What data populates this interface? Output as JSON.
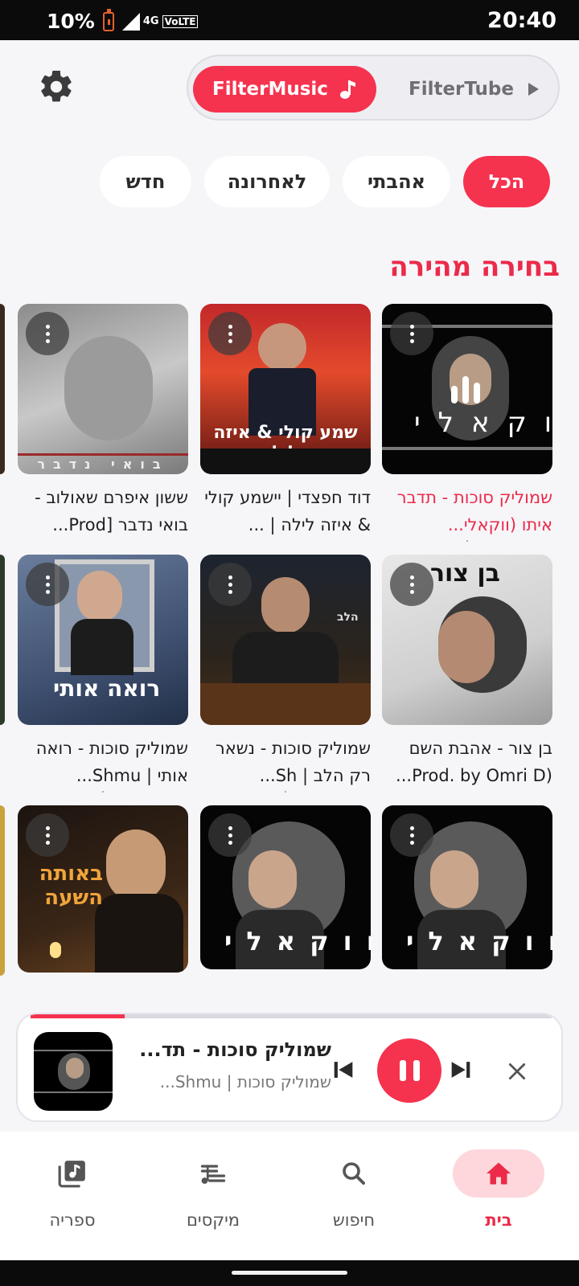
{
  "status_bar": {
    "battery": "10%",
    "network": "4G",
    "volte": "VoLTE",
    "time": "20:40"
  },
  "header": {
    "settings_icon": "gear-icon",
    "segments": [
      {
        "label": "FilterMusic",
        "icon": "music-note-icon",
        "active": true
      },
      {
        "label": "FilterTube",
        "icon": "play-icon",
        "active": false
      }
    ]
  },
  "filter_chips": [
    {
      "label": "הכל",
      "active": true
    },
    {
      "label": "אהבתי",
      "active": false
    },
    {
      "label": "לאחרונה",
      "active": false
    },
    {
      "label": "חדש",
      "active": false
    }
  ],
  "quick_pick": {
    "title": "בחירה מהירה",
    "cards": [
      {
        "title": "שמוליק סוכות - תדבר איתו (ווקאלי...",
        "playing": true,
        "art_text": "ווקאלי"
      },
      {
        "title": "דוד חפצדי | יישמע קולי & איזה לילה | ...",
        "playing": false,
        "art_text": "שמע קולי & איזה ליל"
      },
      {
        "title": "ששון איפרם שאולוב - בואי נדבר [Prod...",
        "playing": false,
        "art_text": "בואי נדבר"
      },
      {
        "title": "בן צור - אהבת השם (Prod. by Omri D...",
        "playing": false,
        "art_text": "בן צור"
      },
      {
        "title": "שמוליק סוכות - נשאר רק הלב | Sh...",
        "playing": false,
        "art_text": "הלב"
      },
      {
        "title": "שמוליק סוכות - רואה אותי | Shmu...",
        "playing": false,
        "art_text": "רואה אותי"
      },
      {
        "title": "",
        "playing": false,
        "art_text": "ווקאלי"
      },
      {
        "title": "",
        "playing": false,
        "art_text": "ווקאלי"
      },
      {
        "title": "",
        "playing": false,
        "art_text": "באותה השעה"
      }
    ]
  },
  "now_playing": {
    "title": "שמוליק סוכות - תד...",
    "subtitle": "שמוליק סוכות | Shmu...",
    "progress": 0.18,
    "controls": [
      "previous-icon",
      "pause-icon",
      "next-icon",
      "close-icon"
    ]
  },
  "bottom_nav": [
    {
      "label": "בית",
      "icon": "home-icon",
      "active": true
    },
    {
      "label": "חיפוש",
      "icon": "search-icon",
      "active": false
    },
    {
      "label": "מיקסים",
      "icon": "playlist-icon",
      "active": false
    },
    {
      "label": "ספריה",
      "icon": "library-icon",
      "active": false
    }
  ],
  "colors": {
    "accent": "#f5334f",
    "accent_text": "#ec2a49",
    "nav_pill": "#fdd7dc"
  }
}
